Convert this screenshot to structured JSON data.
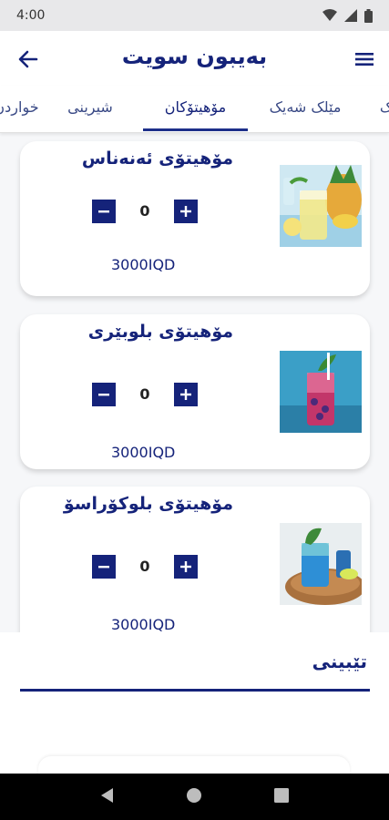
{
  "status_bar": {
    "time": "4:00"
  },
  "app_bar": {
    "title": "بەیبون سویت"
  },
  "tabs": [
    {
      "label": "ک"
    },
    {
      "label": "مێلک شەیک"
    },
    {
      "label": "مۆهیتۆکان",
      "active": true
    },
    {
      "label": "شیرینی"
    },
    {
      "label": "خواردن"
    }
  ],
  "products": [
    {
      "name": "مۆهیتۆی ئەنەناس",
      "quantity": "0",
      "price": "3000IQD"
    },
    {
      "name": "مۆهیتۆی بلوبێری",
      "quantity": "0",
      "price": "3000IQD"
    },
    {
      "name": "مۆهیتۆی بلوکۆراسۆ",
      "quantity": "0",
      "price": "3000IQD"
    }
  ],
  "note": {
    "label": "تێبینی"
  },
  "colors": {
    "primary": "#15237a",
    "background": "#f6f7f9",
    "card": "#ffffff"
  }
}
